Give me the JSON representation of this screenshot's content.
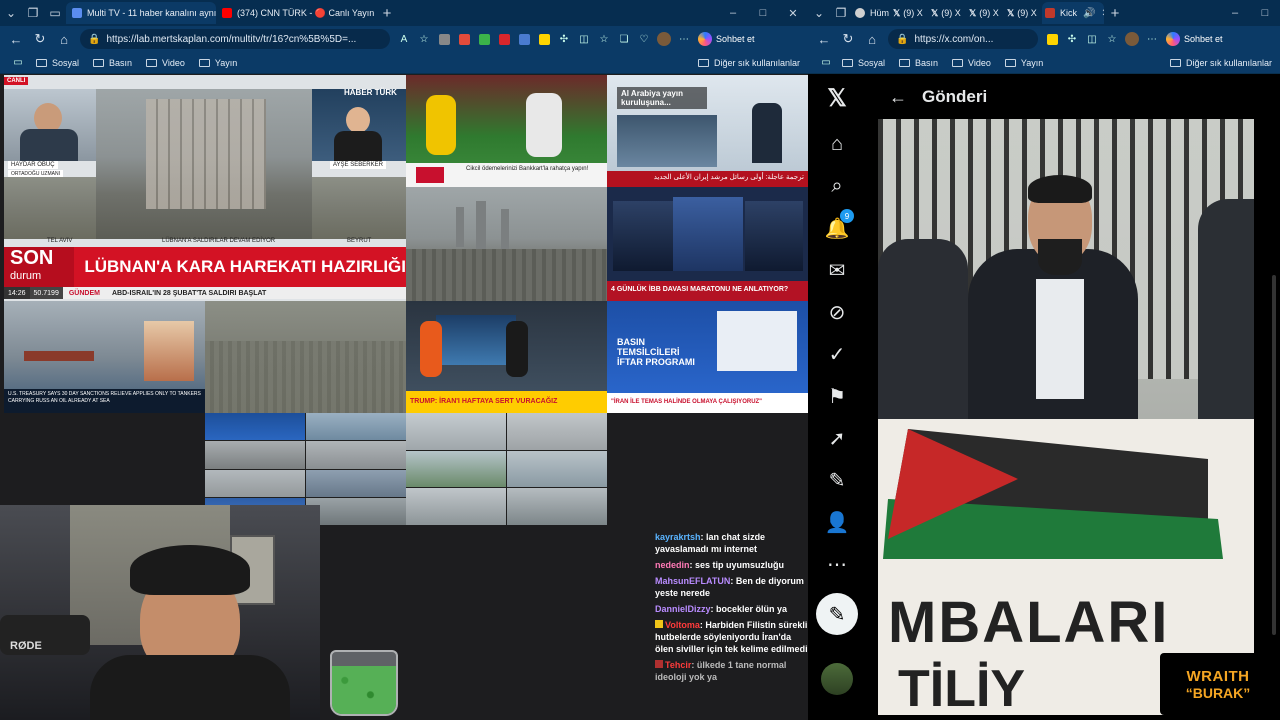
{
  "left_browser": {
    "tabs": [
      {
        "label": "Multi TV - 11 haber kanalını aynı a",
        "active": true,
        "favicon_color": "#5b8def"
      },
      {
        "label": "(374) CNN TÜRK - 🔴 Canlı Yayın",
        "active": false,
        "favicon_color": "#ff0000"
      }
    ],
    "new_tab": "+",
    "window_controls": [
      "–",
      "□",
      "✕"
    ],
    "url": "https://lab.mertskaplan.com/multitv/tr/16?cn%5B%5D=...",
    "chat_button": "Sohbet et",
    "bookmarks": [
      "Sosyal",
      "Basın",
      "Video",
      "Yayın"
    ],
    "bookmarks_right": "Diğer sık kullanılanlar"
  },
  "tv": {
    "live_badge": "CANLI",
    "haber_turk_logo": "HABER TÜRK",
    "guest_name": "HAYDAR OBUÇ",
    "guest_title": "ORTADOĞU UZMANI",
    "anchor_name": "AYŞE SEBERKER",
    "loc_left": "TEL AVIV",
    "loc_mid": "LÜBNAN'A SALDIRILAR DEVAM EDİYOR",
    "loc_right": "BEYRUT",
    "son_durum_top": "SON",
    "son_durum_bottom": "durum",
    "headline": "LÜBNAN'A KARA HAREKATI HAZIRLIĞI",
    "ticker_time": "14:26",
    "ticker_value": "50.7199",
    "ticker_tag": "GÜNDEM",
    "ticker_text": "ABD-İSRAİL'İN 28 ŞUBAT'TA SALDIRI BAŞLAT",
    "sport_caption": "Cikcil ödemelerinizi Bankkart'la rahatça yapın!",
    "alarabiya_caption": "Al Arabiya yayın kuruluşuna...",
    "arabic_banner": "ترجمة عاجلة: أولى رسائل مرشد إيران الأعلى الجديد",
    "ibb_banner": "4 GÜNLÜK İBB DAVASI MARATONU NE ANLATIYOR?",
    "cnn_caption": "TRUMP: İRAN'I HAFTAYA SERT VURACAĞIZ",
    "press_caption": "BASIN TEMSİLCİLERİ İFTAR PROGRAMI",
    "iran_caption": "\"İRAN İLE TEMAS HALİNDE OLMAYA ÇALIŞIYORUZ\"",
    "world_caption": "U.S. TREASURY SAYS 30 DAY SANCTIONS RELIEVE APPLIES ONLY TO TANKERS CARRYING RUSS AN OIL ALREADY AT SEA"
  },
  "chat": [
    {
      "user": "kayrakrtsh",
      "user_color": "#5ab4ff",
      "text": "lan chat sizde yavaslamadı mı internet"
    },
    {
      "user": "nededin",
      "user_color": "#ff7ab6",
      "text": "ses tip uyumsuzluğu"
    },
    {
      "user": "MahsunEFLATUN",
      "user_color": "#b98cff",
      "text": "Ben de diyorum yeste nerede"
    },
    {
      "user": "DannielDizzy",
      "user_color": "#b98cff",
      "text": "bocekler ölün ya"
    },
    {
      "user": "Voltoma",
      "user_color": "#ff3b3b",
      "text": "Harbiden Filistin sürekli hutbelerde söyleniyordu İran'da ölen siviller için tek kelime edilmedi"
    },
    {
      "user": "Tehcir",
      "user_color": "#ff3b3b",
      "text": "ülkede 1 tane normal ideoloji yok ya"
    }
  ],
  "right_browser": {
    "tabs": [
      "Hüm",
      "(9) X",
      "(9) X",
      "(9) X",
      "(9) X",
      "Kick"
    ],
    "url": "https://x.com/on...",
    "chat_button": "Sohbet et",
    "bookmarks": [
      "Sosyal",
      "Basın",
      "Video",
      "Yayın"
    ],
    "bookmarks_right": "Diğer sık kullanılanlar"
  },
  "x": {
    "page_title": "Gönderi",
    "notification_count": "9",
    "video_banner_text": "MBALARI",
    "video_banner_text2": "TİLİY"
  },
  "overlay": {
    "wraith_line1": "WRAITH",
    "wraith_line2": "“BURAK”",
    "mic_brand": "RØDE"
  }
}
